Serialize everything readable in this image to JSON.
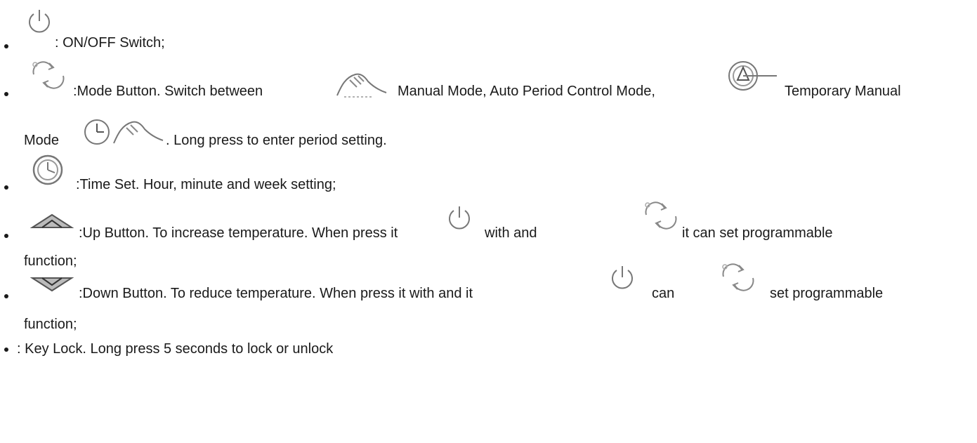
{
  "items": [
    {
      "icon": "power-icon",
      "segments": [
        ": ON/OFF Switch;"
      ]
    },
    {
      "icon": "mode-cycle-icon",
      "segments": [
        ":Mode Button. Switch between",
        "Manual Mode, Auto Period Control Mode,",
        "Temporary Manual",
        "Mode",
        ". Long press to enter period setting."
      ],
      "inline_icons": [
        "manual-hand-icon",
        "auto-period-icon",
        "temporary-manual-icon"
      ]
    },
    {
      "icon": "clock-icon",
      "segments": [
        ":Time Set. Hour, minute and week setting;"
      ]
    },
    {
      "icon": "up-arrow-icon",
      "segments": [
        ":Up Button. To increase temperature. When press it",
        "with and",
        "it can set programmable",
        "function;"
      ],
      "inline_icons": [
        "power-icon",
        "mode-cycle-icon"
      ]
    },
    {
      "icon": "down-arrow-icon",
      "segments": [
        ":Down Button. To reduce temperature. When press it with and it",
        "can",
        "set programmable",
        "function;"
      ],
      "inline_icons": [
        "power-icon",
        "mode-cycle-icon"
      ]
    },
    {
      "icon": "",
      "segments": [
        ": Key Lock. Long press 5 seconds to lock or unlock"
      ]
    }
  ]
}
